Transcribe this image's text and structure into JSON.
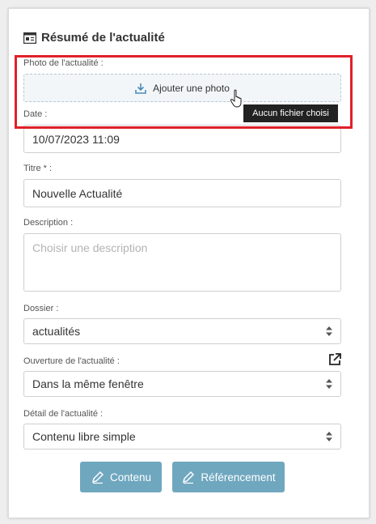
{
  "header": {
    "title": "Résumé de l'actualité",
    "icon": "newspaper-icon"
  },
  "photo": {
    "label": "Photo de l'actualité :",
    "upload_label": "Ajouter une photo",
    "tooltip": "Aucun fichier choisi"
  },
  "date": {
    "label": "Date :",
    "value": "10/07/2023 11:09"
  },
  "titre": {
    "label": "Titre * :",
    "value": "Nouvelle Actualité"
  },
  "description": {
    "label": "Description :",
    "placeholder": "Choisir une description"
  },
  "dossier": {
    "label": "Dossier :",
    "selected": "actualités"
  },
  "ouverture": {
    "label": "Ouverture de l'actualité :",
    "selected": "Dans la même fenêtre"
  },
  "detail": {
    "label": "Détail de l'actualité :",
    "selected": "Contenu libre simple"
  },
  "buttons": {
    "contenu": "Contenu",
    "referencement": "Référencement"
  },
  "colors": {
    "accent_button": "#6fa7bf",
    "highlight": "#e0202a",
    "upload_icon": "#4a8db8"
  }
}
